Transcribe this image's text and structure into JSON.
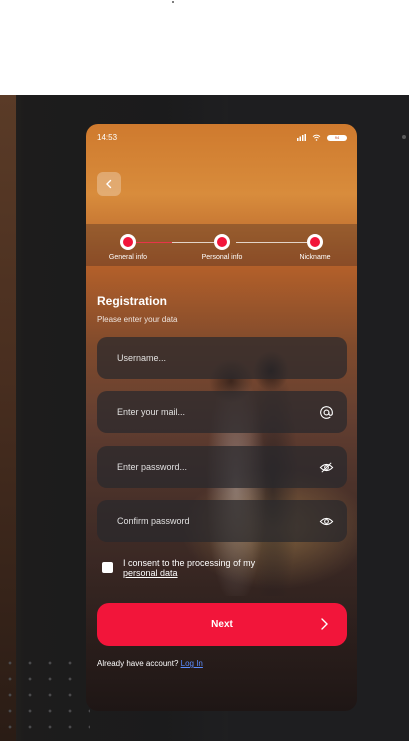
{
  "status_bar": {
    "time": "14:53",
    "battery_label": "94"
  },
  "stepper": {
    "steps": [
      {
        "label": "General info"
      },
      {
        "label": "Personal info"
      },
      {
        "label": "Nickname"
      }
    ],
    "active_step": 1
  },
  "form": {
    "title": "Registration",
    "subtitle": "Please enter your data",
    "username_placeholder": "Username...",
    "email_placeholder": "Enter your mail...",
    "password_placeholder": "Enter password...",
    "confirm_placeholder": "Confirm password",
    "consent_text": "I consent to the processing of my",
    "consent_link": "personal data",
    "next_label": "Next",
    "account_text": "Already have account?",
    "login_label": "Log In"
  },
  "colors": {
    "accent": "#f2153a",
    "link": "#5b8dff"
  },
  "icons": [
    "chevron-left-icon",
    "at-icon",
    "eye-off-icon",
    "eye-icon",
    "chevron-right-icon",
    "signal-icon",
    "wifi-icon",
    "battery-icon"
  ]
}
